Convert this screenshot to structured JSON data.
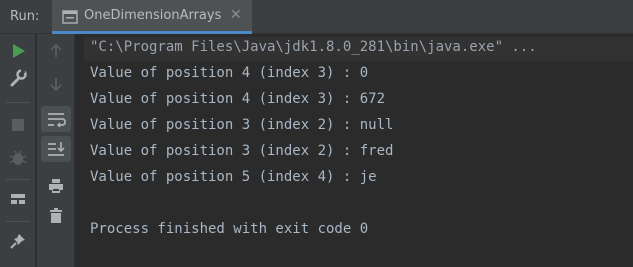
{
  "run_panel": {
    "label": "Run:",
    "tab": {
      "title": "OneDimensionArrays",
      "close_glyph": "✕",
      "icon": "console-window-icon"
    }
  },
  "left_toolbar": {
    "buttons": [
      {
        "icon": "play-icon",
        "color": "#499c54"
      },
      {
        "icon": "wrench-icon",
        "color": "#afb1b3"
      },
      {
        "icon": "stop-icon",
        "color": "#5c5c5c"
      },
      {
        "icon": "bug-icon",
        "color": "#5c5c5c"
      },
      {
        "icon": "layout-icon",
        "color": "#afb1b3"
      },
      {
        "icon": "pin-icon",
        "color": "#afb1b3"
      }
    ]
  },
  "second_toolbar": {
    "buttons": [
      {
        "icon": "arrow-up-icon"
      },
      {
        "icon": "arrow-down-icon"
      },
      {
        "icon": "soft-wrap-icon"
      },
      {
        "icon": "scroll-to-end-icon"
      },
      {
        "icon": "print-icon"
      },
      {
        "icon": "trash-icon"
      }
    ]
  },
  "console": {
    "command": "\"C:\\Program Files\\Java\\jdk1.8.0_281\\bin\\java.exe\" ...",
    "lines": [
      "Value of position 4 (index 3) : 0",
      "Value of position 4 (index 3) : 672",
      "Value of position 3 (index 2) : null",
      "Value of position 3 (index 2) : fred",
      "Value of position 5 (index 4) : je",
      "",
      "Process finished with exit code 0"
    ]
  },
  "colors": {
    "background": "#2b2b2b",
    "panel": "#3c3f41",
    "text": "#a9b7c6",
    "accent": "#4a88c7"
  }
}
